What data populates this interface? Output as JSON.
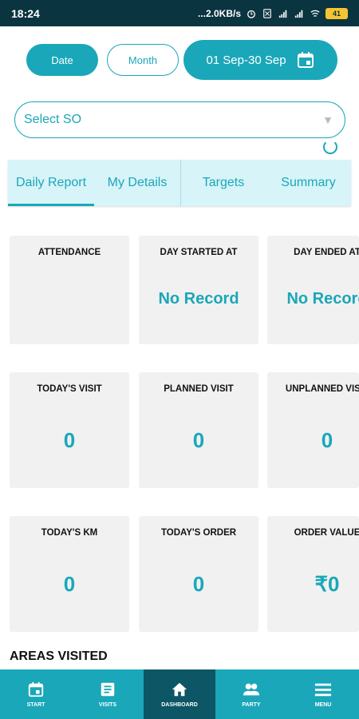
{
  "status_bar": {
    "time": "18:24",
    "network": "...2.0KB/s",
    "battery": "41"
  },
  "filters": {
    "date_label": "Date",
    "month_label": "Month",
    "range_label": "01 Sep-30 Sep"
  },
  "select_so": {
    "placeholder": "Select SO"
  },
  "tabs": [
    {
      "label": "Daily Report",
      "active": true
    },
    {
      "label": "My Details",
      "active": false
    },
    {
      "label": "Targets",
      "active": false
    },
    {
      "label": "Summary",
      "active": false
    }
  ],
  "cards": [
    {
      "label": "ATTENDANCE",
      "value": ""
    },
    {
      "label": "DAY STARTED AT",
      "value": "No Record"
    },
    {
      "label": "DAY ENDED AT",
      "value": "No Record"
    },
    {
      "label": "TODAY'S VISIT",
      "value": "0"
    },
    {
      "label": "PLANNED VISIT",
      "value": "0"
    },
    {
      "label": "UNPLANNED VISIT",
      "value": "0"
    },
    {
      "label": "TODAY'S KM",
      "value": "0"
    },
    {
      "label": "TODAY'S ORDER",
      "value": "0"
    },
    {
      "label": "ORDER VALUE",
      "value": "₹0"
    }
  ],
  "section": {
    "areas_visited": "AREAS VISITED"
  },
  "bottom_nav": [
    {
      "label": "START",
      "icon": "calendar-icon",
      "active": false
    },
    {
      "label": "VISITS",
      "icon": "document-icon",
      "active": false
    },
    {
      "label": "DASHBOARD",
      "icon": "home-icon",
      "active": true
    },
    {
      "label": "PARTY",
      "icon": "people-icon",
      "active": false
    },
    {
      "label": "MENU",
      "icon": "menu-icon",
      "active": false
    }
  ],
  "colors": {
    "accent": "#1aa7b9",
    "status_bar": "#0b3441",
    "tab_bar": "#d7f4f8",
    "card_bg": "#f1f1f1",
    "nav_active": "#0c5665"
  }
}
